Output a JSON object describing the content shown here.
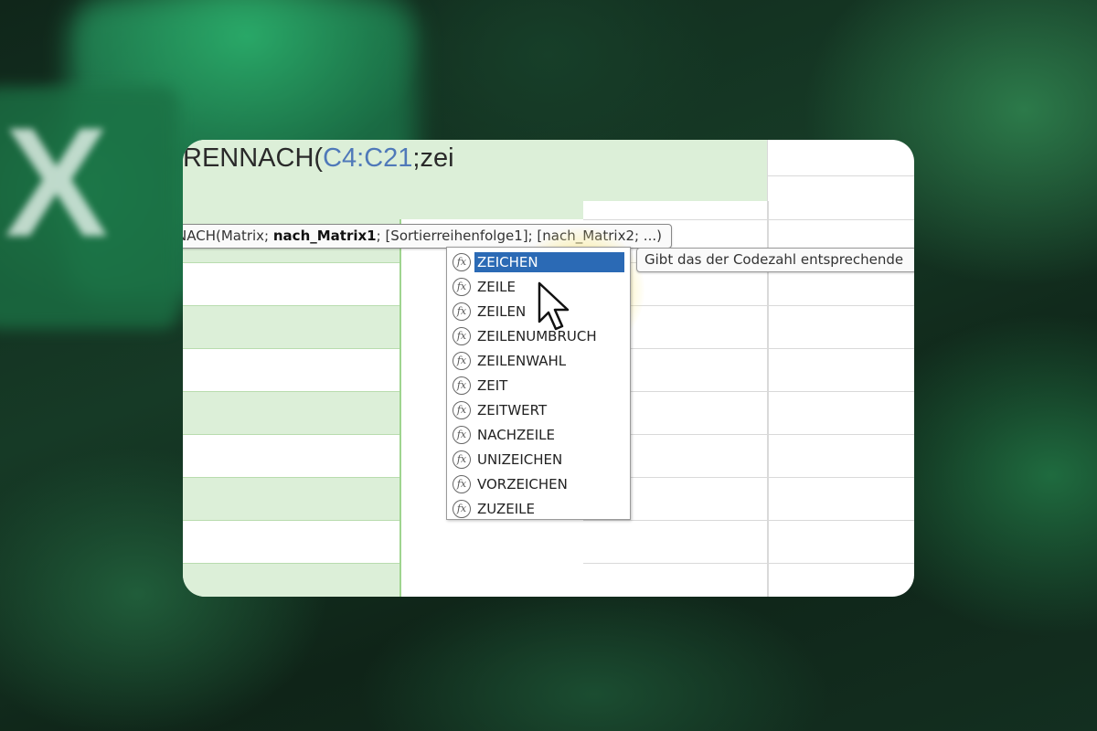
{
  "formula": {
    "prefix": "RENNACH(",
    "range": "C4:C21",
    "suffix": ";zei"
  },
  "syntax_tooltip": {
    "before": "NACH(Matrix; ",
    "bold": "nach_Matrix1",
    "after": "; [Sortierreihenfolge1]; [nach_Matrix2; ...)"
  },
  "autocomplete": {
    "selected_index": 0,
    "items": [
      {
        "label": "ZEICHEN",
        "icon": "function-icon"
      },
      {
        "label": "ZEILE",
        "icon": "function-icon"
      },
      {
        "label": "ZEILEN",
        "icon": "function-icon"
      },
      {
        "label": "ZEILENUMBRUCH",
        "icon": "function-icon"
      },
      {
        "label": "ZEILENWAHL",
        "icon": "function-icon"
      },
      {
        "label": "ZEIT",
        "icon": "function-icon"
      },
      {
        "label": "ZEITWERT",
        "icon": "function-icon"
      },
      {
        "label": "NACHZEILE",
        "icon": "function-icon"
      },
      {
        "label": "UNIZEICHEN",
        "icon": "function-icon"
      },
      {
        "label": "VORZEICHEN",
        "icon": "function-icon"
      },
      {
        "label": "ZUZEILE",
        "icon": "function-icon"
      }
    ]
  },
  "function_description": "Gibt das der Codezahl entsprechende",
  "fx_symbol": "fx",
  "background_logo_letter": "X",
  "colors": {
    "accent_green_fill": "#dcefd8",
    "selection_blue": "#2b6ab5",
    "range_reference": "#4f79b9",
    "excel_green": "#1e7f4a"
  }
}
